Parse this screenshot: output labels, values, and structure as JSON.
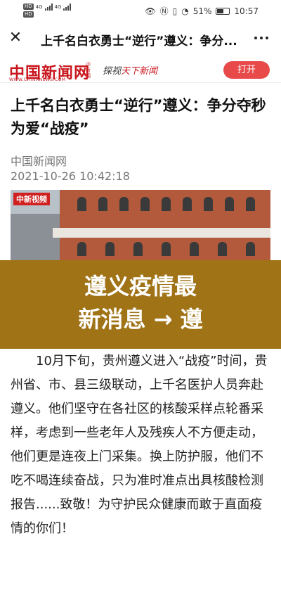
{
  "status_bar": {
    "sim1": "HD",
    "sim2": "HD",
    "net1": "4G",
    "net2": "4G",
    "battery": "51%",
    "time": "10:57"
  },
  "nav": {
    "title": "上千名白衣勇士“逆行”遵义：争分..."
  },
  "brand": {
    "logo": "中国新闻网",
    "logo_sub": "WWW.CHINANEWS.COM",
    "logo_vertical": "中新网",
    "slogan_prefix": "探视",
    "slogan_highlight": "天下新闻",
    "open_button": "打开"
  },
  "article": {
    "headline": "上千名白衣勇士“逆行”遵义：争分夺秒为爱“战疫”",
    "source": "中国新闻网",
    "datetime": "2021-10-26 10:42:18",
    "video_badge": "中新视频",
    "body": "10月下旬，贵州遵义进入“战疫”时间，贵州省、市、县三级联动，上千名医护人员奔赴遵义。他们坚守在各社区的核酸采样点轮番采样，考虑到一些老年人及残疾人不方便走动，他们更是连夜上门采集。换上防护服，他们不吃不喝连续奋战，只为准时准点出具核酸检测报告......致敬！为守护民众健康而敢于直面疫情的你们！"
  },
  "banner": {
    "line1": "遵义疫情最",
    "line2": "新消息 → 遵"
  },
  "colors": {
    "brand_red": "#c8161d",
    "button_red": "#e84a4a",
    "banner_gold": "#a07317"
  }
}
